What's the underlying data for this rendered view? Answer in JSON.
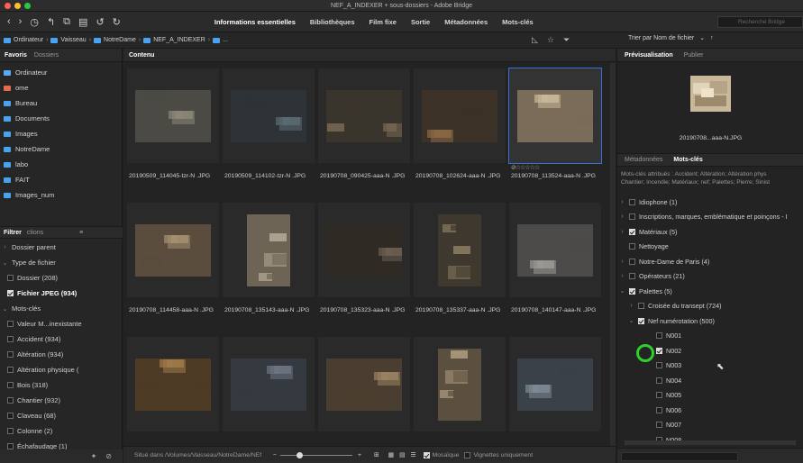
{
  "window": {
    "title": "NEF_A_INDEXER + sous-dossiers - Adobe Bridge",
    "traffic_colors": [
      "#ff5f57",
      "#febc2e",
      "#28c840"
    ]
  },
  "toolbar": {
    "workspaces": [
      "Informations essentielles",
      "Bibliothèques",
      "Film fixe",
      "Sortie",
      "Métadonnées",
      "Mots-clés"
    ],
    "active_workspace": "Informations essentielles",
    "search_placeholder": "Recherche Bridge"
  },
  "path": {
    "crumbs": [
      "Ordinateur",
      "Vaisseau",
      "NotreDame",
      "NEF_A_INDEXER",
      "..."
    ],
    "sort_label": "Trier par Nom de fichier"
  },
  "left_panel": {
    "tabs": [
      "Favoris",
      "Dossiers"
    ],
    "favorites": [
      {
        "label": "Ordinateur",
        "icon": "computer-icon"
      },
      {
        "label": "ome",
        "icon": "home-icon"
      },
      {
        "label": "Bureau",
        "icon": "folder-icon"
      },
      {
        "label": "Documents",
        "icon": "folder-icon"
      },
      {
        "label": "Images",
        "icon": "folder-icon"
      },
      {
        "label": "NotreDame",
        "icon": "folder-icon"
      },
      {
        "label": "labo",
        "icon": "folder-icon"
      },
      {
        "label": "FAIT",
        "icon": "folder-icon"
      },
      {
        "label": "Images_num",
        "icon": "folder-icon"
      }
    ],
    "filter_tabs": [
      "Filtrer",
      "ctions"
    ],
    "filters": [
      {
        "label": "Dossier parent",
        "type": "section"
      },
      {
        "label": "Type de fichier",
        "type": "section"
      },
      {
        "label": "Dossier (208)",
        "type": "item",
        "checked": false
      },
      {
        "label": "Fichier JPEG (934)",
        "type": "item",
        "checked": true
      },
      {
        "label": "Mots-clés",
        "type": "section"
      },
      {
        "label": "Valeur M...inexistante",
        "type": "item",
        "checked": false
      },
      {
        "label": "Accident (934)",
        "type": "item",
        "checked": false
      },
      {
        "label": "Altération (934)",
        "type": "item",
        "checked": false
      },
      {
        "label": "Altération physique (",
        "type": "item",
        "checked": false
      },
      {
        "label": "Bois (318)",
        "type": "item",
        "checked": false
      },
      {
        "label": "Chantier (932)",
        "type": "item",
        "checked": false
      },
      {
        "label": "Claveau (68)",
        "type": "item",
        "checked": false
      },
      {
        "label": "Colonne (2)",
        "type": "item",
        "checked": false
      },
      {
        "label": "Échafaudage (1)",
        "type": "item",
        "checked": false
      }
    ]
  },
  "content": {
    "header": "Contenu",
    "thumbnails": [
      {
        "name": "20190509_114045-tzr-N .JPG",
        "selected": false,
        "portrait": false,
        "tone": [
          "#8d8778",
          "#4b4a45"
        ]
      },
      {
        "name": "20190509_114102-tzr-N .JPG",
        "selected": false,
        "portrait": false,
        "tone": [
          "#5b6b72",
          "#2e3337"
        ]
      },
      {
        "name": "20190708_090425-aaa-N .JPG",
        "selected": false,
        "portrait": false,
        "tone": [
          "#7a6a55",
          "#39342c"
        ]
      },
      {
        "name": "20190708_102624-aaa-N .JPG",
        "selected": false,
        "portrait": false,
        "tone": [
          "#8a6a45",
          "#3c3127"
        ]
      },
      {
        "name": "20190708_113524-aaa-N .JPG",
        "selected": true,
        "portrait": false,
        "tone": [
          "#c9b99a",
          "#7a6c58"
        ]
      },
      {
        "name": "20190708_114458-aaa-N .JPG",
        "selected": false,
        "portrait": false,
        "tone": [
          "#a48f70",
          "#5a4d3e"
        ]
      },
      {
        "name": "20190708_135143-aaa-N .JPG",
        "selected": false,
        "portrait": true,
        "tone": [
          "#b6ab98",
          "#6d6456"
        ]
      },
      {
        "name": "20190708_135323-aaa-N .JPG",
        "selected": false,
        "portrait": false,
        "tone": [
          "#6b5f51",
          "#2f2a24"
        ]
      },
      {
        "name": "20190708_135337-aaa-N .JPG",
        "selected": false,
        "portrait": true,
        "tone": [
          "#8d7d63",
          "#3f382e"
        ]
      },
      {
        "name": "20190708_140147-aaa-N .JPG",
        "selected": false,
        "portrait": false,
        "tone": [
          "#9c9a95",
          "#4c4b49"
        ]
      },
      {
        "name": "",
        "selected": false,
        "portrait": false,
        "tone": [
          "#a07a4a",
          "#4d3b26"
        ]
      },
      {
        "name": "",
        "selected": false,
        "portrait": false,
        "tone": [
          "#6d7580",
          "#343a40"
        ]
      },
      {
        "name": "",
        "selected": false,
        "portrait": false,
        "tone": [
          "#9a8363",
          "#4a3e30"
        ]
      },
      {
        "name": "",
        "selected": false,
        "portrait": true,
        "tone": [
          "#b09d80",
          "#5b5040"
        ]
      },
      {
        "name": "",
        "selected": false,
        "portrait": false,
        "tone": [
          "#7c8a96",
          "#3a4148"
        ]
      }
    ],
    "rating_stars": "⊘☆☆☆☆☆",
    "footer_path": "Situé dans /Volumes/Vaisseau/NotreDame/NEf",
    "view_mode": "Mosaïque",
    "vignettes_label": "Vignettes uniquement"
  },
  "right_panel": {
    "tabs": [
      "Prévisualisation",
      "Publier"
    ],
    "preview_name": "20190708...aaa-N.JPG",
    "kw_tabs": [
      "Métadonnées",
      "Mots-clés"
    ],
    "assigned_line1": "Mots-clés attribués : Accident; Altération; Altération phys",
    "assigned_line2": "Chantier; Incendie; Matériaux; nef; Palettes; Pierre; Sinist",
    "keywords": [
      {
        "label": "Idiophone (1)",
        "indent": 0,
        "twist": "›",
        "checked": false
      },
      {
        "label": "Inscriptions, marques, emblématique et poinçons - I",
        "indent": 0,
        "twist": "›",
        "checked": false
      },
      {
        "label": "Matériaux (5)",
        "indent": 0,
        "twist": "›",
        "checked": true
      },
      {
        "label": "Nettoyage",
        "indent": 0,
        "twist": "",
        "checked": false
      },
      {
        "label": "Notre-Dame de Paris (4)",
        "indent": 0,
        "twist": "›",
        "checked": false
      },
      {
        "label": "Opérateurs (21)",
        "indent": 0,
        "twist": "›",
        "checked": false
      },
      {
        "label": "Palettes (5)",
        "indent": 0,
        "twist": "⌄",
        "checked": true
      },
      {
        "label": "Croisée du transept (724)",
        "indent": 1,
        "twist": "›",
        "checked": false
      },
      {
        "label": "Nef numérotation (500)",
        "indent": 1,
        "twist": "⌄",
        "checked": true
      },
      {
        "label": "N001",
        "indent": 2,
        "twist": "",
        "checked": false
      },
      {
        "label": "N002",
        "indent": 2,
        "twist": "",
        "checked": true
      },
      {
        "label": "N003",
        "indent": 2,
        "twist": "",
        "checked": false
      },
      {
        "label": "N004",
        "indent": 2,
        "twist": "",
        "checked": false
      },
      {
        "label": "N005",
        "indent": 2,
        "twist": "",
        "checked": false
      },
      {
        "label": "N006",
        "indent": 2,
        "twist": "",
        "checked": false
      },
      {
        "label": "N007",
        "indent": 2,
        "twist": "",
        "checked": false
      },
      {
        "label": "N008",
        "indent": 2,
        "twist": "",
        "checked": false
      }
    ]
  },
  "highlight_color": "#2bd12b"
}
